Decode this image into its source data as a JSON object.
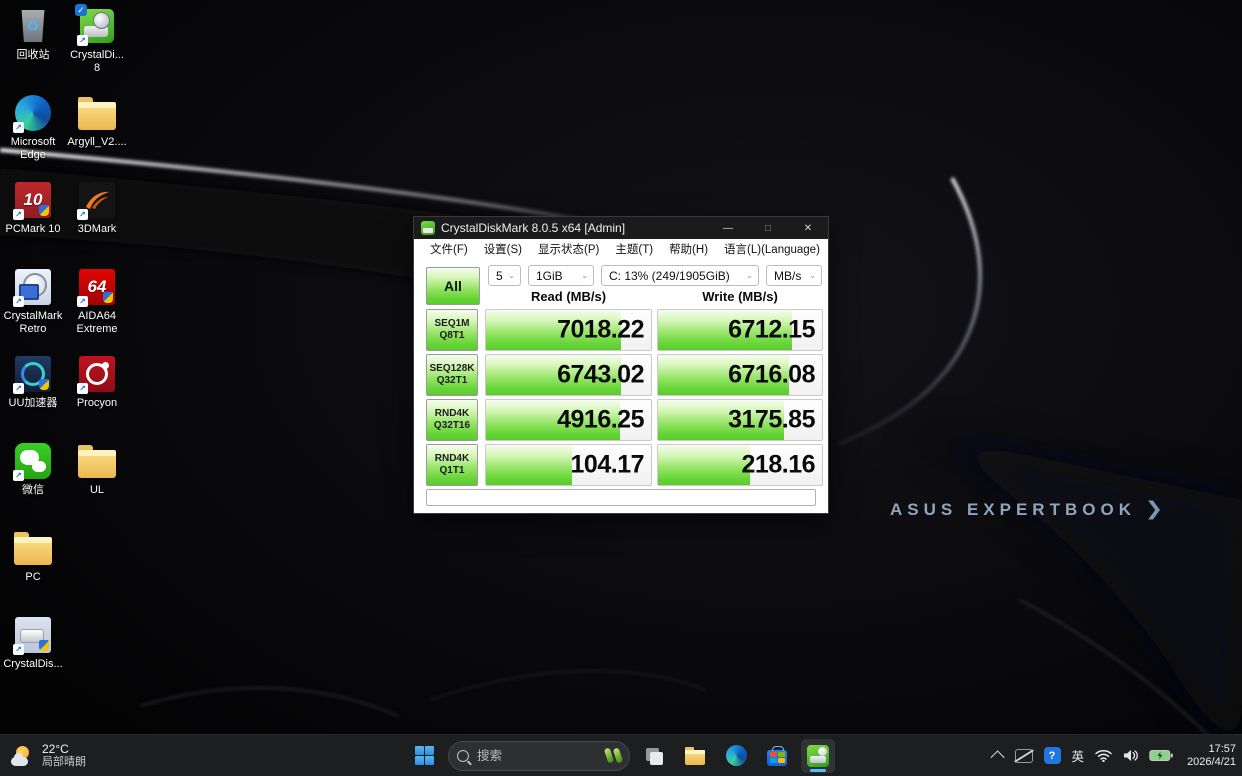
{
  "desktop": {
    "check_glyph": "✓",
    "shortcut_glyph": "↗",
    "recycle_glyph": "♻",
    "icons": [
      {
        "label": "回收站"
      },
      {
        "label": "CrystalDi...\n8"
      },
      {
        "label": "Microsoft\nEdge"
      },
      {
        "label": "Argyll_V2...."
      },
      {
        "label": "PCMark 10",
        "badge": "10"
      },
      {
        "label": "3DMark"
      },
      {
        "label": "CrystalMark\nRetro"
      },
      {
        "label": "AIDA64\nExtreme",
        "badge": "64"
      },
      {
        "label": "UU加速器"
      },
      {
        "label": "Procyon"
      },
      {
        "label": "微信"
      },
      {
        "label": "UL"
      },
      {
        "label": "PC"
      },
      {
        "label": "CrystalDis..."
      }
    ]
  },
  "window": {
    "title": "CrystalDiskMark 8.0.5 x64 [Admin]",
    "titlebar_buttons": {
      "minimize": "—",
      "maximize": "□",
      "close": "✕"
    },
    "menu": [
      "文件(F)",
      "设置(S)",
      "显示状态(P)",
      "主题(T)",
      "帮助(H)",
      "语言(L)(Language)"
    ],
    "controls": {
      "all": "All",
      "count": "5",
      "size": "1GiB",
      "drive": "C: 13% (249/1905GiB)",
      "unit": "MB/s",
      "dropdown_glyph": "⌄"
    },
    "columns": {
      "read": "Read (MB/s)",
      "write": "Write (MB/s)"
    },
    "rows": [
      {
        "test": "SEQ1M",
        "queue": "Q8T1",
        "read": "7018.22",
        "write": "6712.15",
        "read_fill": 82,
        "write_fill": 82
      },
      {
        "test": "SEQ128K",
        "queue": "Q32T1",
        "read": "6743.02",
        "write": "6716.08",
        "read_fill": 82,
        "write_fill": 80
      },
      {
        "test": "RND4K",
        "queue": "Q32T16",
        "read": "4916.25",
        "write": "3175.85",
        "read_fill": 81,
        "write_fill": 77
      },
      {
        "test": "RND4K",
        "queue": "Q1T1",
        "read": "104.17",
        "write": "218.16",
        "read_fill": 52,
        "write_fill": 56
      }
    ],
    "comment": ""
  },
  "wallpaper": {
    "brand": "ASUS EXPERTBOOK",
    "chevron": "❯"
  },
  "taskbar": {
    "weather": {
      "temp": "22°C",
      "condition": "局部晴朗"
    },
    "search": {
      "placeholder": "搜索"
    },
    "tray": {
      "language": "英",
      "blue_badge": "?",
      "time": "17:57",
      "date": "2026/4/21"
    }
  }
}
